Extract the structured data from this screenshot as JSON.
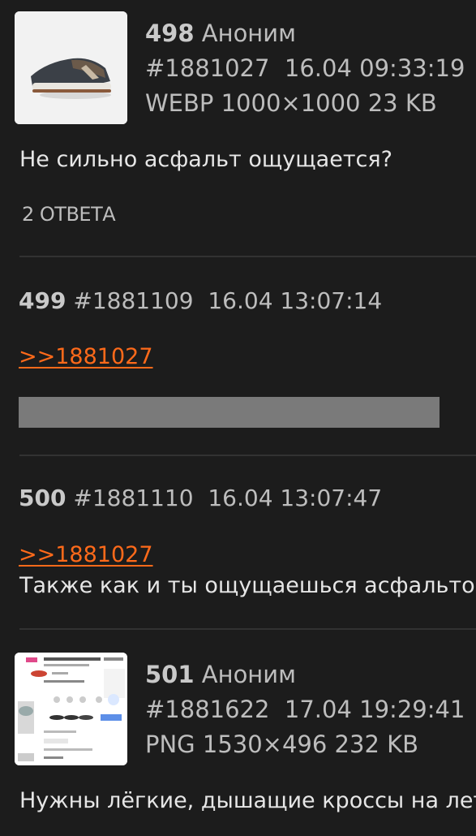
{
  "posts": [
    {
      "number": "498",
      "author": "Аноним",
      "id": "#1881027",
      "date": "16.04 09:33:19",
      "file": "WEBP 1000×1000 23 KB",
      "text": "Не сильно асфальт ощущается?",
      "answers": "2 ОТВЕТА"
    },
    {
      "number": "499",
      "id": "#1881109",
      "date": "16.04 13:07:14",
      "reply": ">>1881027"
    },
    {
      "number": "500",
      "id": "#1881110",
      "date": "16.04 13:07:47",
      "reply": ">>1881027",
      "text": "Также как и ты ощущаешься асфальтом"
    },
    {
      "number": "501",
      "author": "Аноним",
      "id": "#1881622",
      "date": "17.04 19:29:41",
      "file": "PNG 1530×496 232 KB",
      "text": "Нужны лёгкие, дышащие кроссы на лето"
    }
  ],
  "icons": {
    "thumb1": "sneaker-image",
    "thumb2": "shop-screenshot-image"
  }
}
